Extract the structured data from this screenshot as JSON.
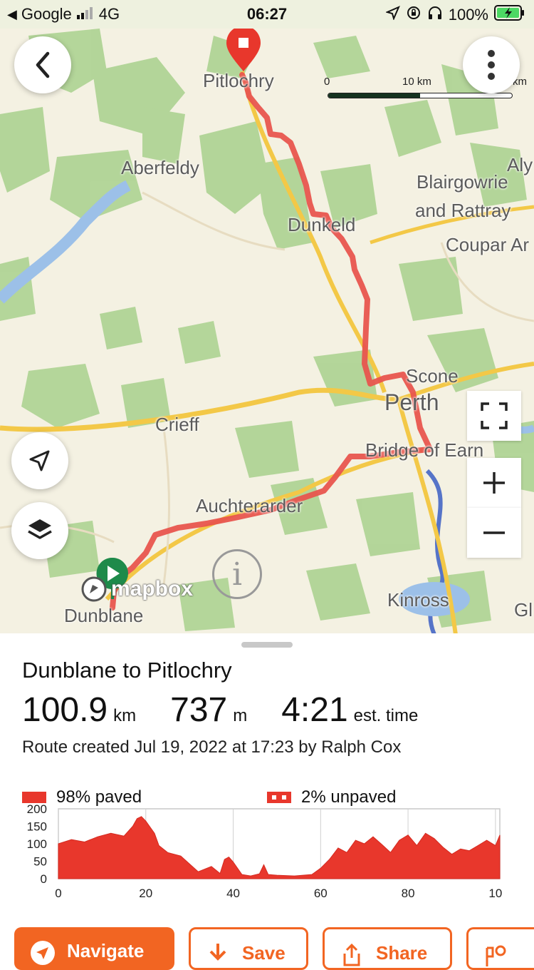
{
  "status_bar": {
    "carrier": "Google",
    "network": "4G",
    "time": "06:27",
    "battery": "100%"
  },
  "map": {
    "labels": {
      "pitlochry": "Pitlochry",
      "aberfeldy": "Aberfeldy",
      "blairgowrie": "Blairgowrie",
      "rattray": "and Rattray",
      "coupar": "Coupar Ar",
      "aly": "Aly",
      "dunkeld": "Dunkeld",
      "scone": "Scone",
      "perth": "Perth",
      "crieff": "Crieff",
      "bridge_of_earn": "Bridge of Earn",
      "auchterarder": "Auchterarder",
      "dunblane": "Dunblane",
      "kinross": "Kinross",
      "gl": "Gl"
    },
    "scale": {
      "zero": "0",
      "mid": "10 km",
      "end": "km"
    },
    "attribution": "mapbox",
    "route_color": "#e8554e",
    "accent": "#f26522"
  },
  "route": {
    "title": "Dunblane to Pitlochry",
    "distance_value": "100.9",
    "distance_unit": "km",
    "elevation_value": "737",
    "elevation_unit": "m",
    "time_value": "4:21",
    "time_unit": "est. time",
    "created": "Route created Jul 19, 2022 at 17:23 by Ralph Cox"
  },
  "surface": {
    "paved": "98% paved",
    "unpaved": "2% unpaved"
  },
  "chart_data": {
    "type": "area",
    "y_ticks": [
      "200",
      "150",
      "100",
      "50",
      "0"
    ],
    "x_ticks": [
      "0",
      "20",
      "40",
      "60",
      "80",
      "10"
    ],
    "ylim": [
      0,
      200
    ],
    "xlim": [
      0,
      101
    ],
    "x": [
      0,
      3,
      6,
      9,
      12,
      15,
      17,
      18,
      19,
      20,
      22,
      23,
      25,
      28,
      32,
      35,
      37,
      38,
      39,
      40,
      42,
      44,
      46,
      47,
      48,
      50,
      54,
      58,
      60,
      62,
      64,
      66,
      68,
      70,
      72,
      74,
      76,
      78,
      80,
      82,
      84,
      86,
      88,
      90,
      92,
      94,
      96,
      98,
      100,
      101
    ],
    "series": [
      {
        "values": [
          100,
          112,
          105,
          120,
          130,
          122,
          150,
          172,
          178,
          165,
          130,
          95,
          75,
          65,
          20,
          35,
          15,
          55,
          62,
          48,
          12,
          8,
          14,
          40,
          12,
          10,
          8,
          12,
          30,
          55,
          88,
          75,
          110,
          100,
          120,
          98,
          75,
          110,
          125,
          95,
          130,
          115,
          90,
          70,
          85,
          80,
          95,
          110,
          95,
          125
        ]
      }
    ]
  },
  "actions": {
    "navigate": "Navigate",
    "save": "Save",
    "share": "Share"
  }
}
